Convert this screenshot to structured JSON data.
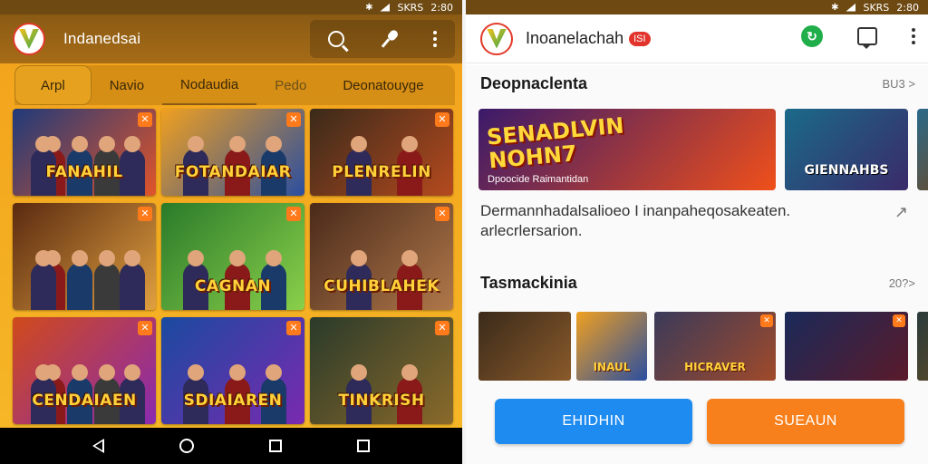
{
  "status_bar": {
    "time": "2:80",
    "signal_text": "SKRS",
    "bt": "✱"
  },
  "left_screen": {
    "app_title": "Indanedsai",
    "tabs": [
      "Arpl",
      "Navio",
      "Nodaudia",
      "Pedo",
      "Deonatouyge"
    ],
    "tiles": [
      {
        "title": "FANAHIL",
        "colors": [
          "#1f3a7a",
          "#e0542a"
        ]
      },
      {
        "title": "FOTANDAIAR",
        "colors": [
          "#f0a020",
          "#2a4ea0"
        ]
      },
      {
        "title": "PLENRELIN",
        "colors": [
          "#3a2a1a",
          "#b54a1e"
        ]
      },
      {
        "title": "",
        "colors": [
          "#5a2a10",
          "#e0a040"
        ]
      },
      {
        "title": "CAGNAN",
        "colors": [
          "#2a7a2a",
          "#8ad04a"
        ]
      },
      {
        "title": "CUHIBLAHEK",
        "colors": [
          "#4a2a1a",
          "#b0784a"
        ]
      },
      {
        "title": "CENDAIAEN",
        "colors": [
          "#d04a1a",
          "#8a2ab0"
        ]
      },
      {
        "title": "SDIAIAREN",
        "colors": [
          "#1a4aa0",
          "#7a2ab0"
        ]
      },
      {
        "title": "TINKRISH",
        "colors": [
          "#2a3a2a",
          "#8a6a2a"
        ]
      }
    ],
    "icons": [
      "search-icon",
      "mic-icon",
      "more-vert-icon"
    ]
  },
  "right_screen": {
    "app_title": "Inoanelachah",
    "title_badge": "ISI",
    "featured_section": {
      "title": "Deopnaclenta",
      "more": "BU3 >"
    },
    "featured_cards": [
      {
        "big_text": "SENADLVIN\nNOHN7",
        "small_text": "Dpoocide Raimantidan",
        "colors": [
          "#3a1a6a",
          "#f0501a"
        ]
      },
      {
        "title": "GIENNAHBS",
        "colors": [
          "#1a6a8a",
          "#3a2a6a"
        ]
      },
      {
        "title": "",
        "colors": [
          "#2a6a8a",
          "#6a4a2a"
        ]
      }
    ],
    "description_line1": "Dermannhadalsalioeo I inanpaheqosakeaten.",
    "description_line2": "arlecrlersarion.",
    "second_section": {
      "title": "Tasmackinia",
      "more": "20?>"
    },
    "screenshots": [
      {
        "title": "",
        "colors": [
          "#3a2a1a",
          "#8a5a2a"
        ]
      },
      {
        "title": "INAUL",
        "colors": [
          "#f0a020",
          "#2a4ea0"
        ]
      },
      {
        "title": "HICRAVER",
        "colors": [
          "#3a3a5a",
          "#a04a2a"
        ]
      },
      {
        "title": "",
        "colors": [
          "#1a2a5a",
          "#5a1a2a"
        ]
      },
      {
        "title": "",
        "colors": [
          "#2a3a3a",
          "#5a4a2a"
        ]
      }
    ],
    "buttons": {
      "primary": "EHIDHIN",
      "secondary": "SUEAUN"
    }
  }
}
